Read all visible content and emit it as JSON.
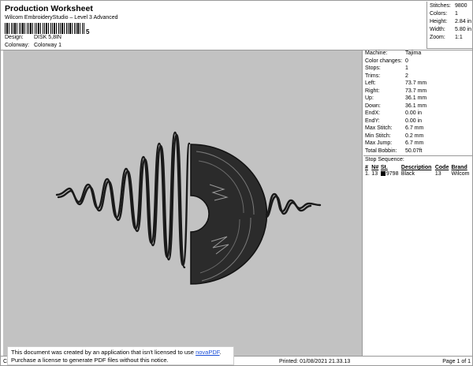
{
  "header": {
    "title": "Production Worksheet",
    "subtitle": "Wilcom EmbroideryStudio – Level 3 Advanced",
    "barcode_digit": "5",
    "design_label": "Design:",
    "design_value": "DISK 5,8IN",
    "colorway_label": "Colorway:",
    "colorway_value": "Colorway 1"
  },
  "summary": [
    {
      "label": "Stitches:",
      "value": "9800"
    },
    {
      "label": "Colors:",
      "value": "1"
    },
    {
      "label": "Height:",
      "value": "2.84 in"
    },
    {
      "label": "Width:",
      "value": "5.80 in"
    },
    {
      "label": "Zoom:",
      "value": "1:1"
    }
  ],
  "machine_info": [
    {
      "label": "Machine:",
      "value": "Tajima"
    },
    {
      "label": "Color changes:",
      "value": "0"
    },
    {
      "label": "Stops:",
      "value": "1"
    },
    {
      "label": "Trims:",
      "value": "2"
    },
    {
      "label": "Left:",
      "value": "73.7 mm"
    },
    {
      "label": "Right:",
      "value": "73.7 mm"
    },
    {
      "label": "Up:",
      "value": "36.1 mm"
    },
    {
      "label": "Down:",
      "value": "36.1 mm"
    },
    {
      "label": "EndX:",
      "value": "0.00 in"
    },
    {
      "label": "EndY:",
      "value": "0.00 in"
    },
    {
      "label": "Max Stitch:",
      "value": "6.7 mm"
    },
    {
      "label": "Min Stitch:",
      "value": "0.2 mm"
    },
    {
      "label": "Max Jump:",
      "value": "6.7 mm"
    },
    {
      "label": "Total Bobbin:",
      "value": "50.07ft"
    }
  ],
  "stop_sequence": {
    "title": "Stop Sequence:",
    "headers": [
      "#",
      "N#",
      "St.",
      "Description",
      "Code",
      "Brand"
    ],
    "rows": [
      {
        "num": "1.",
        "n": "13",
        "st": "9798",
        "description": "Black",
        "code": "13",
        "brand": "Wilcom"
      }
    ]
  },
  "footer": {
    "left": "Cr",
    "printed": "Printed: 01/08/2021 21.33.13",
    "page": "Page 1 of 1"
  },
  "notice": {
    "line1_prefix": "This document was created by an application that isn't licensed to use ",
    "link": "novaPDF",
    "line1_suffix": ".",
    "line2": "Purchase a license to generate PDF files without this notice."
  },
  "colors": {
    "design_bg": "#c2c2c2",
    "thread": "#1a1a1a"
  }
}
